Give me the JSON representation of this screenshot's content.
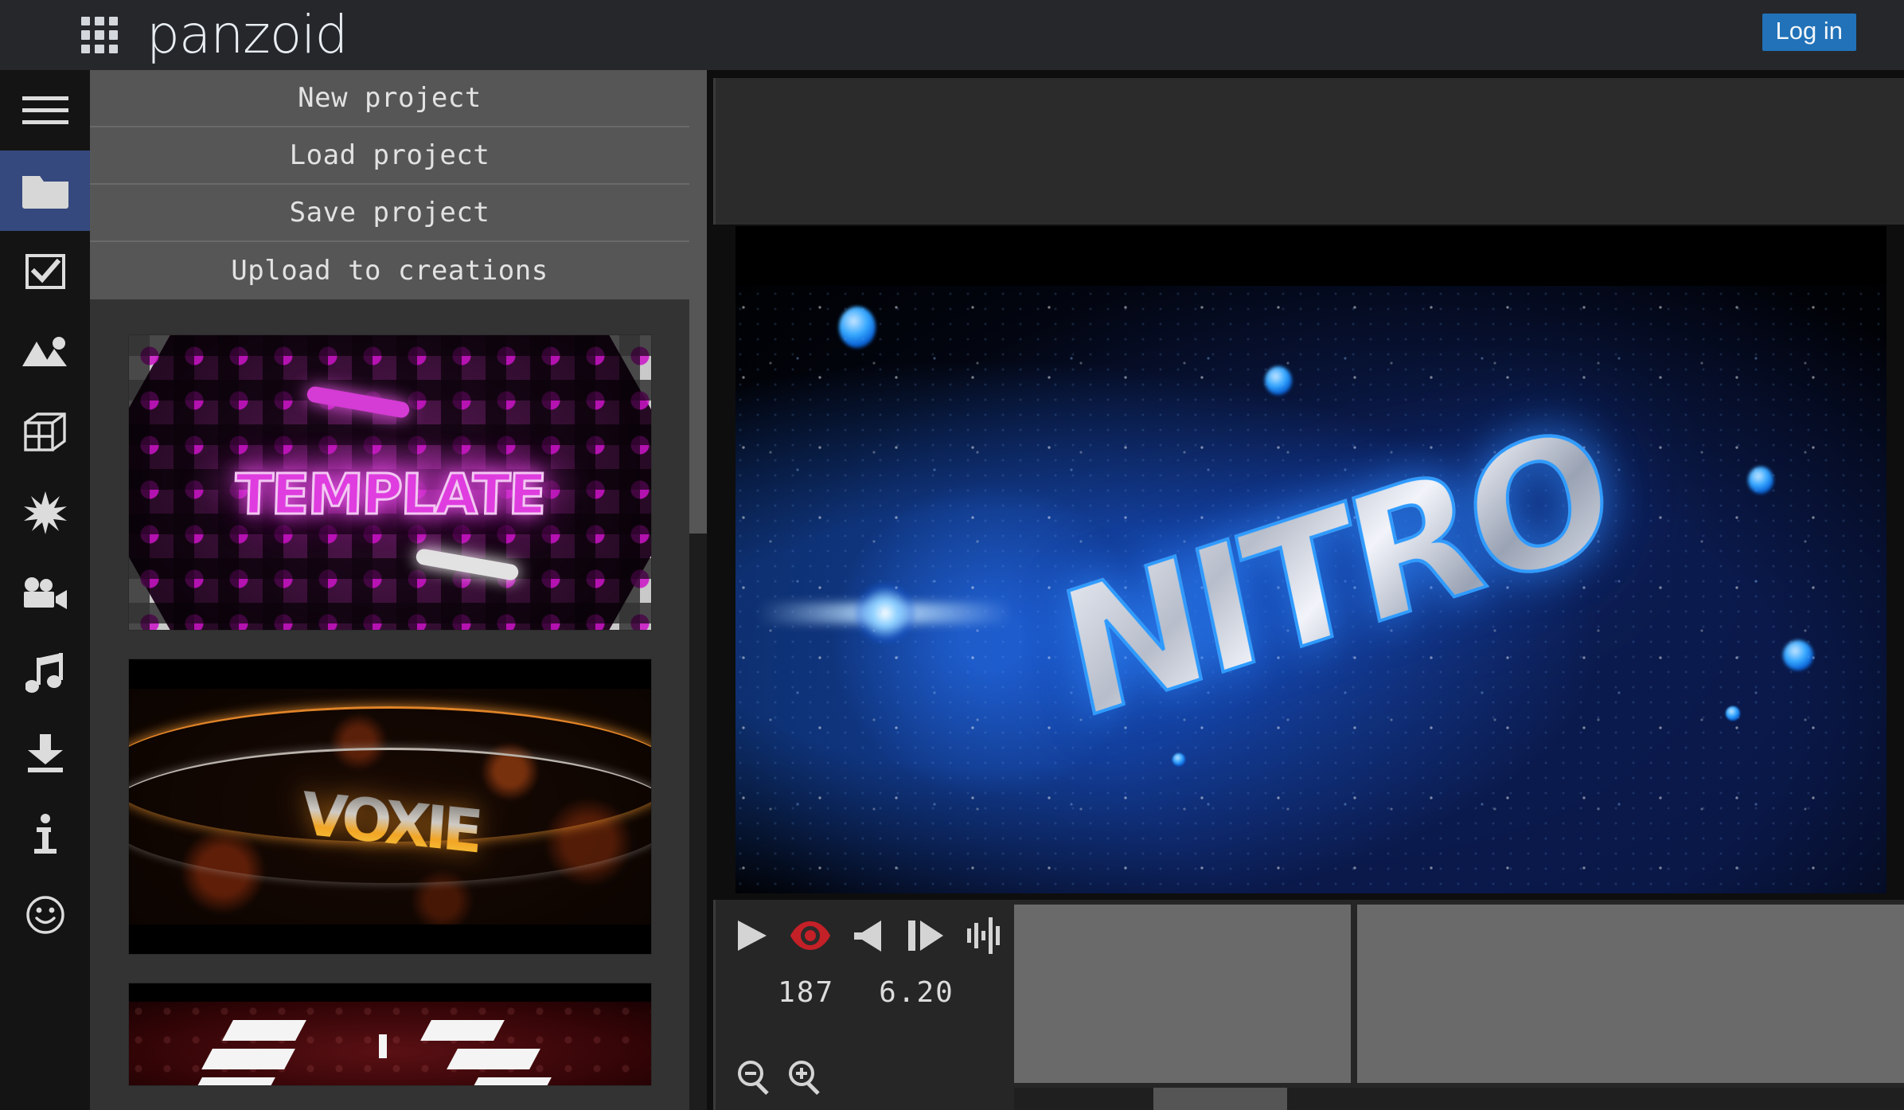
{
  "app": {
    "brand": "panzoid"
  },
  "topbar": {
    "grid_icon": "apps-grid-icon",
    "login_label": "Log in"
  },
  "rail": {
    "items": [
      {
        "icon": "hamburger-menu-icon",
        "name": "menu",
        "active": false
      },
      {
        "icon": "folder-icon",
        "name": "project",
        "active": true
      },
      {
        "icon": "checkbox-icon",
        "name": "selection",
        "active": false
      },
      {
        "icon": "image-icon",
        "name": "image",
        "active": false
      },
      {
        "icon": "cube-icon",
        "name": "object-3d",
        "active": false
      },
      {
        "icon": "starburst-icon",
        "name": "effects",
        "active": false
      },
      {
        "icon": "video-camera-icon",
        "name": "camera",
        "active": false
      },
      {
        "icon": "music-note-icon",
        "name": "audio",
        "active": false
      },
      {
        "icon": "download-arrow-icon",
        "name": "download",
        "active": false
      },
      {
        "icon": "info-icon",
        "name": "info",
        "active": false
      },
      {
        "icon": "smiley-face-icon",
        "name": "feedback",
        "active": false
      }
    ]
  },
  "panel": {
    "menu": [
      {
        "label": "New project"
      },
      {
        "label": "Load project"
      },
      {
        "label": "Save project"
      },
      {
        "label": "Upload to creations"
      }
    ],
    "thumbnails": [
      {
        "name": "template-purple-grid",
        "title": "TEMPLATE"
      },
      {
        "name": "template-orange-fire",
        "title": "VOXIE"
      },
      {
        "name": "template-red-angular",
        "title": ""
      }
    ]
  },
  "preview": {
    "title_text": "NITRO"
  },
  "timeline": {
    "controls": [
      {
        "icon": "play-icon",
        "name": "play-button"
      },
      {
        "icon": "eye-icon",
        "name": "visibility-toggle",
        "color": "#c42027"
      },
      {
        "icon": "speaker-icon",
        "name": "mute-button"
      },
      {
        "icon": "step-forward-icon",
        "name": "step-forward-button"
      },
      {
        "icon": "waveform-icon",
        "name": "audio-waveform-button"
      }
    ],
    "frame": "187",
    "time": "6.20",
    "zoom_out": "zoom-out-icon",
    "zoom_in": "zoom-in-icon"
  },
  "colors": {
    "accent_blue": "#2172b8",
    "active_rail": "#35497e",
    "menu_bg": "#565656",
    "panel_bg": "#333333",
    "eye_red": "#c42027"
  }
}
